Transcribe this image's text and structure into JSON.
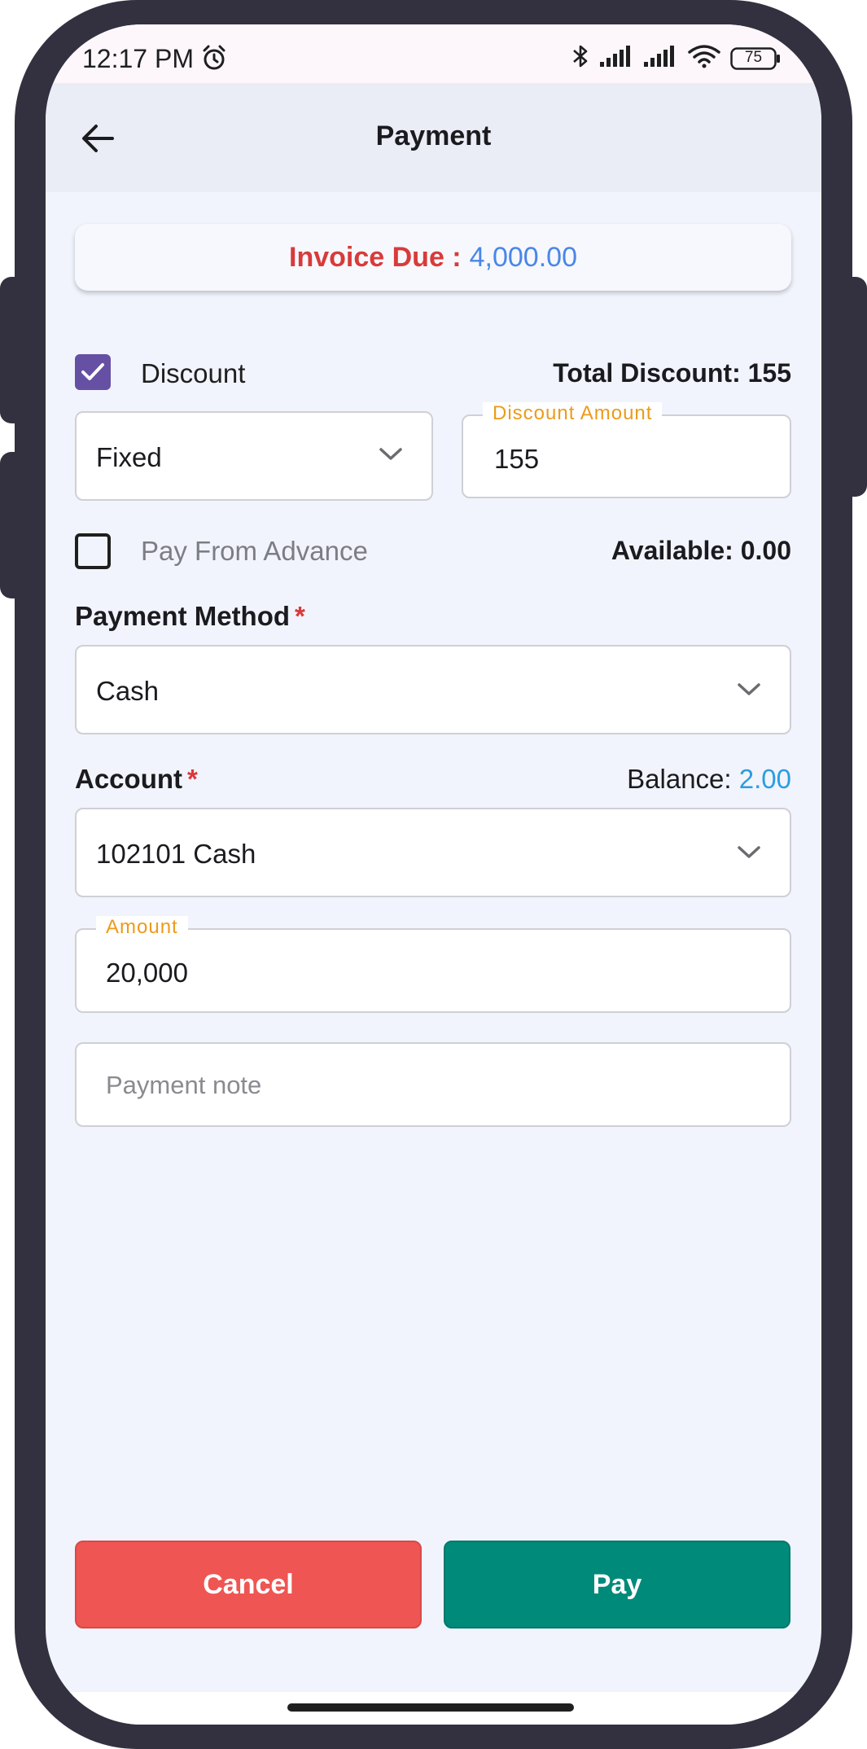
{
  "status_bar": {
    "time": "12:17 PM",
    "battery": "75",
    "icons": [
      "alarm-icon",
      "bluetooth-icon",
      "signal-icon",
      "signal-icon",
      "wifi-icon",
      "battery-icon"
    ]
  },
  "app_bar": {
    "title": "Payment",
    "back_icon": "arrow-left-icon"
  },
  "invoice": {
    "label": "Invoice Due :",
    "amount": "4,000.00"
  },
  "discount": {
    "checkbox_label": "Discount",
    "checked": true,
    "total_discount": "Total Discount: 155",
    "type_value": "Fixed",
    "amount_label": "Discount Amount",
    "amount_value": "155"
  },
  "advance": {
    "checkbox_label": "Pay From Advance",
    "checked": false,
    "available": "Available: 0.00"
  },
  "payment_method": {
    "label": "Payment Method",
    "required_mark": "*",
    "value": "Cash"
  },
  "account": {
    "label": "Account",
    "required_mark": "*",
    "balance_label": "Balance:",
    "balance_value": "2.00",
    "value": "102101 Cash"
  },
  "amount": {
    "label": "Amount",
    "value": "20,000"
  },
  "note": {
    "placeholder": "Payment note"
  },
  "actions": {
    "cancel_label": "Cancel",
    "pay_label": "Pay"
  },
  "colors": {
    "invoice_label": "#d93a3a",
    "invoice_amount": "#4a86e8",
    "checkbox_checked": "#6650a4",
    "floating_label": "#ec9b1a",
    "balance_value": "#2a9de0",
    "cancel_button": "#ef5552",
    "pay_button": "#008a7a"
  }
}
